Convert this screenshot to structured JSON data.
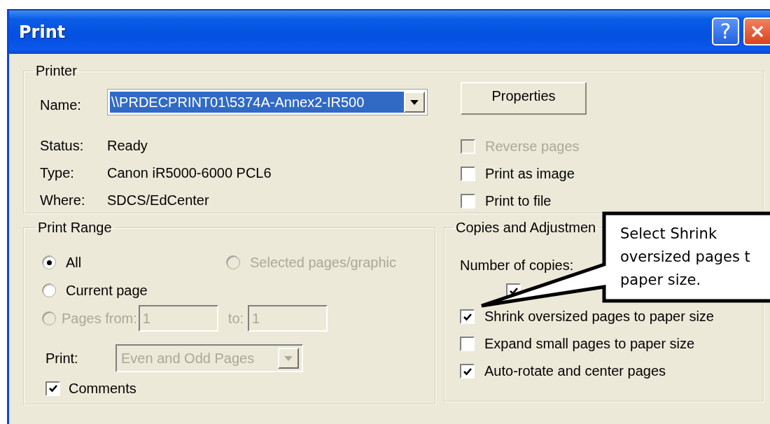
{
  "window": {
    "title": "Print",
    "title_buttons": [
      {
        "kind": "help",
        "label": "?"
      },
      {
        "kind": "close"
      }
    ]
  },
  "printer": {
    "label": "Printer",
    "name_label": "Name:",
    "name_value": "\\\\PRDECPRINT01\\5374A-Annex2-IR500",
    "properties_button": "Properties",
    "info": [
      {
        "label": "Status:",
        "value": "Ready"
      },
      {
        "label": "Type:",
        "value": "Canon iR5000-6000 PCL6"
      },
      {
        "label": "Where:",
        "value": "SDCS/EdCenter"
      }
    ],
    "options": [
      {
        "label": "Reverse pages",
        "checked": false,
        "disabled": true
      },
      {
        "label": "Print as image",
        "checked": false,
        "disabled": false
      },
      {
        "label": "Print to file",
        "checked": false,
        "disabled": false
      }
    ]
  },
  "print_range": {
    "label": "Print Range",
    "options": [
      {
        "label": "All",
        "selected": true,
        "disabled": false
      },
      {
        "label": "Selected pages/graphic",
        "selected": false,
        "disabled": true
      },
      {
        "label": "Current page",
        "selected": false,
        "disabled": false
      },
      {
        "label": "Pages from:",
        "selected": false,
        "disabled": true
      }
    ],
    "from_value": "1",
    "to_label": "to:",
    "to_value": "1",
    "pages_disabled": true,
    "print_label": "Print:",
    "print_value": "Even and Odd Pages",
    "print_disabled": true,
    "comments": {
      "label": "Comments",
      "checked": true
    }
  },
  "copies": {
    "label": "Copies and Adjustmen",
    "number_label": "Number of copies:",
    "collate": {
      "checked": true
    },
    "options": [
      {
        "label": "Shrink oversized pages to paper size",
        "checked": true
      },
      {
        "label": "Expand small pages to paper size",
        "checked": false
      },
      {
        "label": "Auto-rotate and center pages",
        "checked": true
      }
    ]
  },
  "callout": {
    "lines": [
      "Select Shrink",
      "oversized pages t",
      "paper size."
    ]
  }
}
